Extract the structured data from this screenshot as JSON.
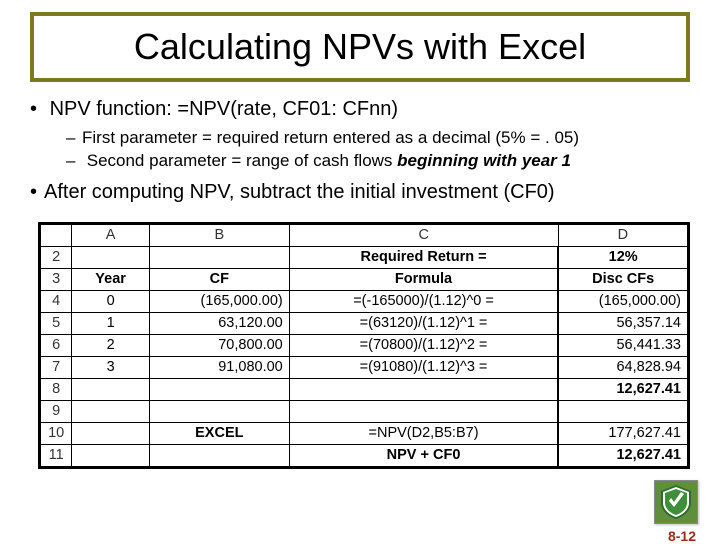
{
  "title": "Calculating NPVs with Excel",
  "bullets": {
    "b1a": "NPV function: =NPV(rate, CF01: CFnn)",
    "sub1": "First parameter = required return entered as a decimal (5% = . 05)",
    "sub2_before": "Second parameter = range of cash flows ",
    "sub2_em": "beginning with year 1",
    "b1b": "After computing NPV, subtract the initial investment (CF0)"
  },
  "sheet": {
    "colLetters": {
      "A": "A",
      "B": "B",
      "C": "C",
      "D": "D"
    },
    "rows": [
      {
        "n": "2",
        "A": "",
        "B": "",
        "C": "Required Return  =",
        "D": "12%",
        "hdr": true
      },
      {
        "n": "3",
        "A": "Year",
        "B": "CF",
        "C": "Formula",
        "D": "Disc CFs",
        "hdr": true
      },
      {
        "n": "4",
        "A": "0",
        "B": "(165,000.00)",
        "C": "=(-165000)/(1.12)^0 =",
        "D": "(165,000.00)"
      },
      {
        "n": "5",
        "A": "1",
        "B": "63,120.00",
        "C": "=(63120)/(1.12)^1 =",
        "D": "56,357.14"
      },
      {
        "n": "6",
        "A": "2",
        "B": "70,800.00",
        "C": "=(70800)/(1.12)^2 =",
        "D": "56,441.33"
      },
      {
        "n": "7",
        "A": "3",
        "B": "91,080.00",
        "C": "=(91080)/(1.12)^3 =",
        "D": "64,828.94"
      },
      {
        "n": "8",
        "A": "",
        "B": "",
        "C": "",
        "D": "12,627.41",
        "dbold": true
      },
      {
        "n": "9",
        "A": "",
        "B": "",
        "C": "",
        "D": ""
      },
      {
        "n": "10",
        "A": "",
        "B": "EXCEL",
        "C": "=NPV(D2,B5:B7)",
        "D": "177,627.41",
        "bbold": true
      },
      {
        "n": "11",
        "A": "",
        "B": "",
        "C": "NPV + CF0",
        "D": "12,627.41",
        "cbold": true,
        "dbold": true
      }
    ]
  },
  "page": "8-12"
}
